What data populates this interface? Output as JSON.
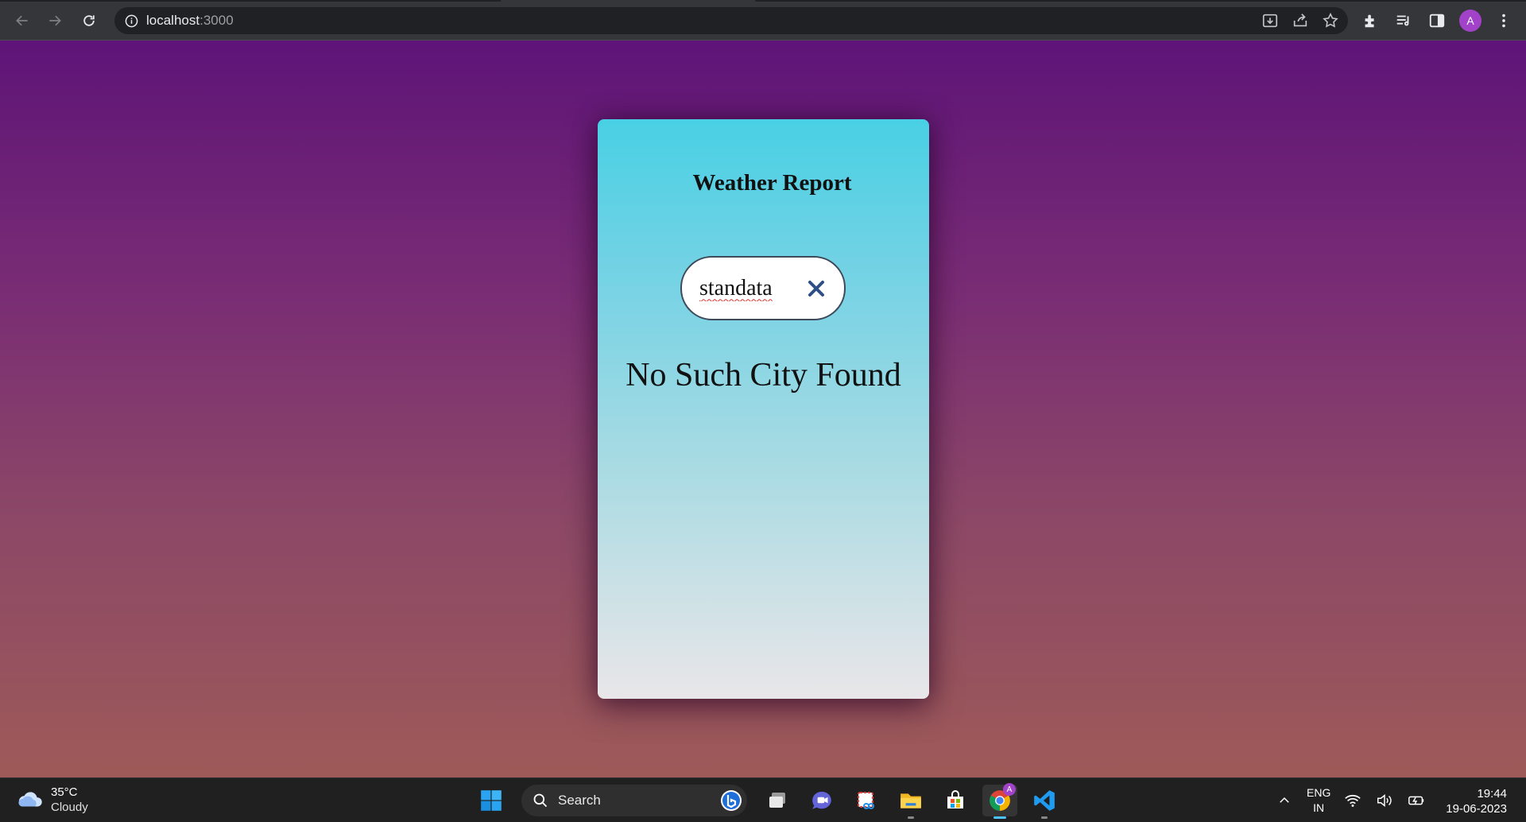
{
  "browser": {
    "url_host": "localhost",
    "url_port": ":3000",
    "profile_initial": "A"
  },
  "app": {
    "title": "Weather Report",
    "search_value": "standata",
    "message": "No Such City Found"
  },
  "taskbar": {
    "weather_temp": "35°C",
    "weather_desc": "Cloudy",
    "search_label": "Search",
    "lang_top": "ENG",
    "lang_bottom": "IN",
    "time": "19:44",
    "date": "19-06-2023",
    "chrome_badge": "A"
  }
}
